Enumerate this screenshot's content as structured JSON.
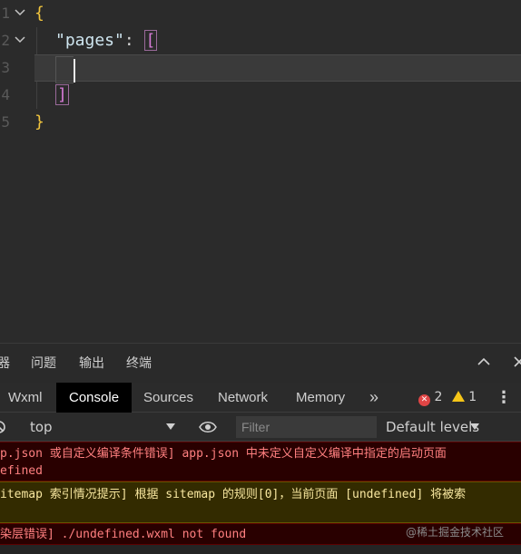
{
  "editor": {
    "line_numbers": [
      "1",
      "2",
      "3",
      "4",
      "5"
    ],
    "line1": "{",
    "line2_key": "\"pages\"",
    "line2_colon": ": ",
    "line2_bracket": "[",
    "line4_bracket": "]",
    "line5": "}"
  },
  "panel": {
    "tabs": [
      "器",
      "问题",
      "输出",
      "终端"
    ],
    "devtools_tabs": {
      "wxml": "Wxml",
      "console": "Console",
      "sources": "Sources",
      "network": "Network",
      "memory": "Memory",
      "more": "»"
    },
    "error_count": "2",
    "warning_count": "1",
    "context": "top",
    "filter_placeholder": "Filter",
    "levels": "Default levels"
  },
  "messages": [
    {
      "type": "error",
      "lines": [
        "p.json 或自定义编译条件错误] app.json 中未定义自定义编译中指定的启动页面",
        "efined"
      ]
    },
    {
      "type": "warning",
      "lines": [
        "itemap 索引情况提示] 根据 sitemap 的规则[0]，当前页面 [undefined] 将被索"
      ]
    },
    {
      "type": "error",
      "lines": [
        "染层错误] ./undefined.wxml not found"
      ]
    }
  ],
  "watermark": "@稀土掘金技术社区",
  "colors": {
    "error_bg": "#290000",
    "warning_bg": "#332b00",
    "brace": "#f2c53d",
    "bracket": "#d87bd8"
  }
}
